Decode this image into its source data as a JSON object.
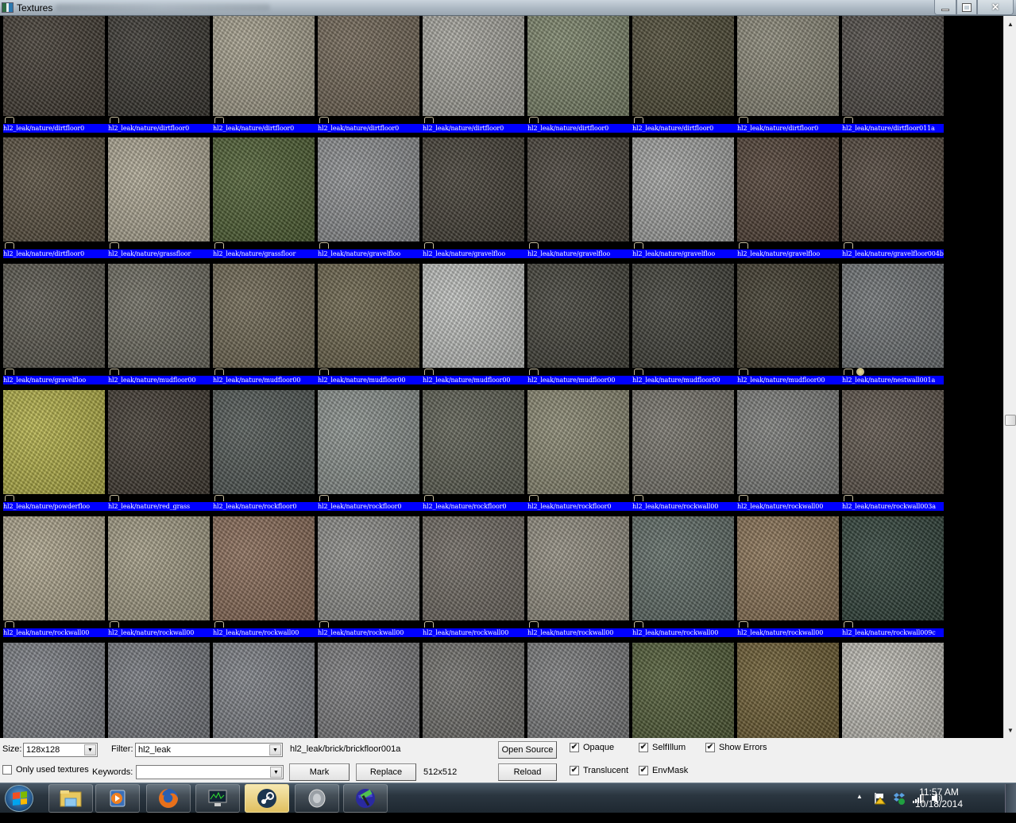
{
  "window": {
    "title": "Textures",
    "buttons": {
      "minimize": "minimize",
      "restore": "restore",
      "close": "close"
    }
  },
  "grid": {
    "columns": 9,
    "rows": [
      {
        "labels": [
          "hl2_leak/nature/dirtfloor0",
          "hl2_leak/nature/dirtfloor0",
          "hl2_leak/nature/dirtfloor0",
          "hl2_leak/nature/dirtfloor0",
          "hl2_leak/nature/dirtfloor0",
          "hl2_leak/nature/dirtfloor0",
          "hl2_leak/nature/dirtfloor0",
          "hl2_leak/nature/dirtfloor0",
          "hl2_leak/nature/dirtfloor011a"
        ],
        "colors": [
          "#3d362d",
          "#33302a",
          "#a6a08c",
          "#6f6352",
          "#a8a79f",
          "#7b8468",
          "#4a4630",
          "#8a8776",
          "#4a4540"
        ]
      },
      {
        "labels": [
          "hl2_leak/nature/dirtfloor0",
          "hl2_leak/nature/grassfloor",
          "hl2_leak/nature/grassfloor",
          "hl2_leak/nature/gravelfloo",
          "hl2_leak/nature/gravelfloo",
          "hl2_leak/nature/gravelfloo",
          "hl2_leak/nature/gravelfloo",
          "hl2_leak/nature/gravelfloo",
          "hl2_leak/nature/gravelfloor004b"
        ],
        "colors": [
          "#554b3a",
          "#b1aa95",
          "#4b5d2e",
          "#8e9092",
          "#3f3a30",
          "#423c33",
          "#a4a5a3",
          "#4d3c30",
          "#4c4035"
        ]
      },
      {
        "labels": [
          "hl2_leak/nature/gravelfloo",
          "hl2_leak/nature/mudfloor00",
          "hl2_leak/nature/mudfloor00",
          "hl2_leak/nature/mudfloor00",
          "hl2_leak/nature/mudfloor00",
          "hl2_leak/nature/mudfloor00",
          "hl2_leak/nature/mudfloor00",
          "hl2_leak/nature/mudfloor00",
          "hl2_leak/nature/nestwall001a"
        ],
        "colors": [
          "#57544a",
          "#6c6a5e",
          "#6e6650",
          "#6a6248",
          "#c3c5c2",
          "#3e3d34",
          "#3a3a32",
          "#3a3526",
          "#6e7274"
        ]
      },
      {
        "labels": [
          "hl2_leak/nature/powderfloo",
          "hl2_leak/nature/red_grass",
          "hl2_leak/nature/rockfloor0",
          "hl2_leak/nature/rockfloor0",
          "hl2_leak/nature/rockfloor0",
          "hl2_leak/nature/rockfloor0",
          "hl2_leak/nature/rockwall00",
          "hl2_leak/nature/rockwall00",
          "hl2_leak/nature/rockwall003a"
        ],
        "colors": [
          "#b8b545",
          "#3c352c",
          "#4e5552",
          "#8a918d",
          "#5b5d50",
          "#8a8870",
          "#76736a",
          "#7c7d7a",
          "#5a5046"
        ]
      },
      {
        "labels": [
          "hl2_leak/nature/rockwall00",
          "hl2_leak/nature/rockwall00",
          "hl2_leak/nature/rockwall00",
          "hl2_leak/nature/rockwall00",
          "hl2_leak/nature/rockwall00",
          "hl2_leak/nature/rockwall00",
          "hl2_leak/nature/rockwall00",
          "hl2_leak/nature/rockwall00",
          "hl2_leak/nature/rockwall009c"
        ],
        "colors": [
          "#b1a88e",
          "#a59e85",
          "#8a6a55",
          "#8e8e8a",
          "#6e6860",
          "#938e80",
          "#5d6a64",
          "#8a7152",
          "#2a3d34"
        ]
      },
      {
        "labels": [],
        "colors": [
          "#7c7f85",
          "#76797f",
          "#7d8086",
          "#7a7a7c",
          "#6f6e6a",
          "#7a7b7c",
          "#4e5a32",
          "#6b5a2d",
          "#c2c0b8"
        ]
      }
    ]
  },
  "controls": {
    "size_label": "Size:",
    "size_value": "128x128",
    "filter_label": "Filter:",
    "filter_value": "hl2_leak",
    "current_texture": "hl2_leak/brick/brickfloor001a",
    "only_used_label": "Only used textures",
    "only_used_checked": false,
    "keywords_label": "Keywords:",
    "keywords_value": "",
    "mark_label": "Mark",
    "replace_label": "Replace",
    "texture_size": "512x512",
    "open_source_label": "Open Source",
    "reload_label": "Reload",
    "checkboxes": [
      {
        "label": "Opaque",
        "checked": true
      },
      {
        "label": "SelfIllum",
        "checked": true
      },
      {
        "label": "Show Errors",
        "checked": true
      },
      {
        "label": "Translucent",
        "checked": true
      },
      {
        "label": "EnvMask",
        "checked": true
      }
    ]
  },
  "taskbar": {
    "items": [
      "start-button",
      "windows-explorer",
      "windows-media-player",
      "firefox",
      "resource-monitor",
      "steam",
      "speaker-app",
      "hammer-editor"
    ],
    "active": "steam",
    "time": "11:57 AM",
    "date": "10/18/2014",
    "tray_icons": [
      "show-hidden-icons",
      "action-center-flag",
      "dropbox",
      "network-signal",
      "volume"
    ]
  }
}
